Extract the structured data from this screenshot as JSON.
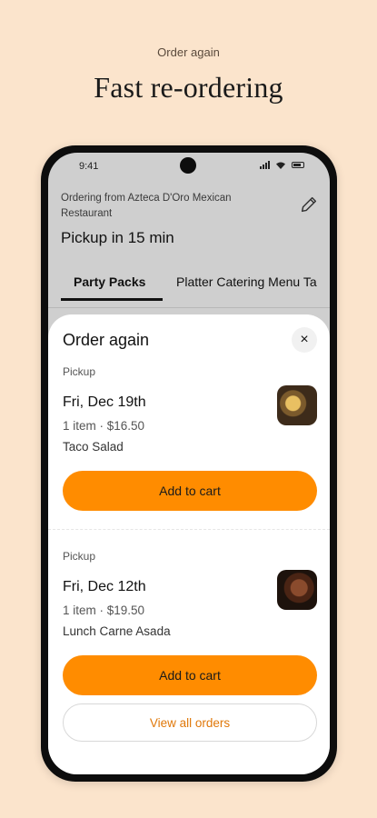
{
  "hero": {
    "eyebrow": "Order again",
    "headline": "Fast re-ordering"
  },
  "statusbar": {
    "time": "9:41"
  },
  "header": {
    "ordering_from": "Ordering from Azteca D'Oro Mexican Restaurant",
    "pickup_time": "Pickup in 15 min"
  },
  "tabs": [
    {
      "label": "Party Packs",
      "active": true
    },
    {
      "label": "Platter Catering Menu Ta",
      "active": false
    }
  ],
  "sheet": {
    "title": "Order again",
    "close_label": "×",
    "orders": [
      {
        "type": "Pickup",
        "date": "Fri, Dec 19th",
        "meta": "1 item · $16.50",
        "item": "Taco Salad",
        "button": "Add to cart"
      },
      {
        "type": "Pickup",
        "date": "Fri, Dec 12th",
        "meta": "1 item · $19.50",
        "item": "Lunch Carne Asada",
        "button": "Add to cart"
      }
    ],
    "view_all": "View all orders"
  },
  "colors": {
    "background": "#fbe4cc",
    "accent": "#ff8c00",
    "link": "#e0780a"
  }
}
